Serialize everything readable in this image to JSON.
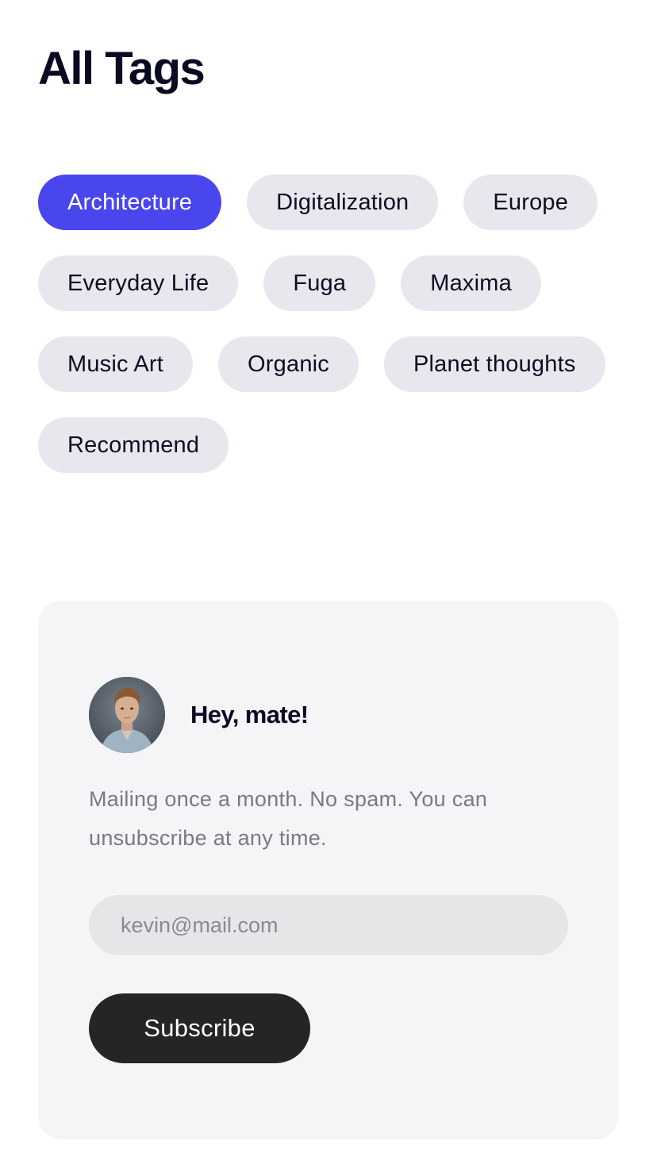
{
  "header": {
    "title": "All Tags"
  },
  "tags": [
    {
      "label": "Architecture",
      "active": true
    },
    {
      "label": "Digitalization",
      "active": false
    },
    {
      "label": "Europe",
      "active": false
    },
    {
      "label": "Everyday Life",
      "active": false
    },
    {
      "label": "Fuga",
      "active": false
    },
    {
      "label": "Maxima",
      "active": false
    },
    {
      "label": "Music Art",
      "active": false
    },
    {
      "label": "Organic",
      "active": false
    },
    {
      "label": "Planet thoughts",
      "active": false
    },
    {
      "label": "Recommend",
      "active": false
    }
  ],
  "newsletter": {
    "greeting": "Hey, mate!",
    "description": "Mailing once a month. No spam. You can unsubscribe at any time.",
    "email_placeholder": "kevin@mail.com",
    "subscribe_label": "Subscribe",
    "avatar_icon": "person-portrait-icon"
  },
  "colors": {
    "accent": "#4a46ee",
    "tag_bg": "#e7e7ee",
    "card_bg": "#f5f5f8",
    "button_bg": "#252527"
  }
}
